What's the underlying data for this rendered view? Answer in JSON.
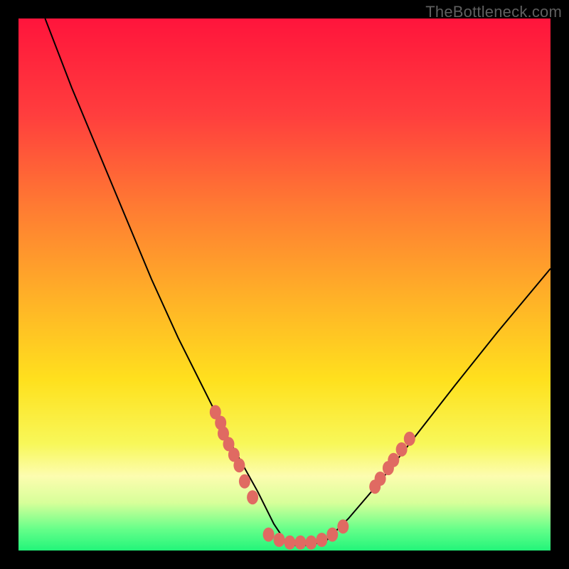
{
  "watermark": "TheBottleneck.com",
  "chart_data": {
    "type": "line",
    "title": "",
    "xlabel": "",
    "ylabel": "",
    "xlim": [
      0,
      100
    ],
    "ylim": [
      0,
      100
    ],
    "series": [
      {
        "name": "bottleneck-curve",
        "x": [
          5,
          10,
          15,
          20,
          25,
          30,
          35,
          40,
          45,
          48,
          50,
          52,
          55,
          58,
          62,
          68,
          75,
          82,
          90,
          100
        ],
        "y": [
          100,
          87,
          75,
          63,
          51,
          40,
          30,
          20,
          11,
          5,
          2,
          1,
          1,
          2,
          6,
          13,
          22,
          31,
          41,
          53
        ]
      }
    ],
    "marker_clusters": [
      {
        "name": "left-cluster",
        "points": [
          {
            "x": 37,
            "y": 26
          },
          {
            "x": 38,
            "y": 24
          },
          {
            "x": 38.5,
            "y": 22
          },
          {
            "x": 39.5,
            "y": 20
          },
          {
            "x": 40.5,
            "y": 18
          },
          {
            "x": 41.5,
            "y": 16
          },
          {
            "x": 42.5,
            "y": 13
          },
          {
            "x": 44,
            "y": 10
          }
        ]
      },
      {
        "name": "bottom-cluster",
        "points": [
          {
            "x": 47,
            "y": 3
          },
          {
            "x": 49,
            "y": 2
          },
          {
            "x": 51,
            "y": 1.5
          },
          {
            "x": 53,
            "y": 1.5
          },
          {
            "x": 55,
            "y": 1.5
          },
          {
            "x": 57,
            "y": 2
          },
          {
            "x": 59,
            "y": 3
          },
          {
            "x": 61,
            "y": 4.5
          }
        ]
      },
      {
        "name": "right-cluster",
        "points": [
          {
            "x": 67,
            "y": 12
          },
          {
            "x": 68,
            "y": 13.5
          },
          {
            "x": 69.5,
            "y": 15.5
          },
          {
            "x": 70.5,
            "y": 17
          },
          {
            "x": 72,
            "y": 19
          },
          {
            "x": 73.5,
            "y": 21
          }
        ]
      }
    ],
    "background_gradient": {
      "stops": [
        {
          "pos": 0.0,
          "color": "#ff153c"
        },
        {
          "pos": 0.18,
          "color": "#ff3e3e"
        },
        {
          "pos": 0.35,
          "color": "#ff7a33"
        },
        {
          "pos": 0.52,
          "color": "#ffb028"
        },
        {
          "pos": 0.68,
          "color": "#ffe11e"
        },
        {
          "pos": 0.8,
          "color": "#f8f85a"
        },
        {
          "pos": 0.86,
          "color": "#fdfdb0"
        },
        {
          "pos": 0.91,
          "color": "#d8ff9a"
        },
        {
          "pos": 0.96,
          "color": "#66ff8a"
        },
        {
          "pos": 1.0,
          "color": "#23f57a"
        }
      ]
    },
    "colors": {
      "curve": "#000000",
      "marker": "#e06a62"
    }
  }
}
